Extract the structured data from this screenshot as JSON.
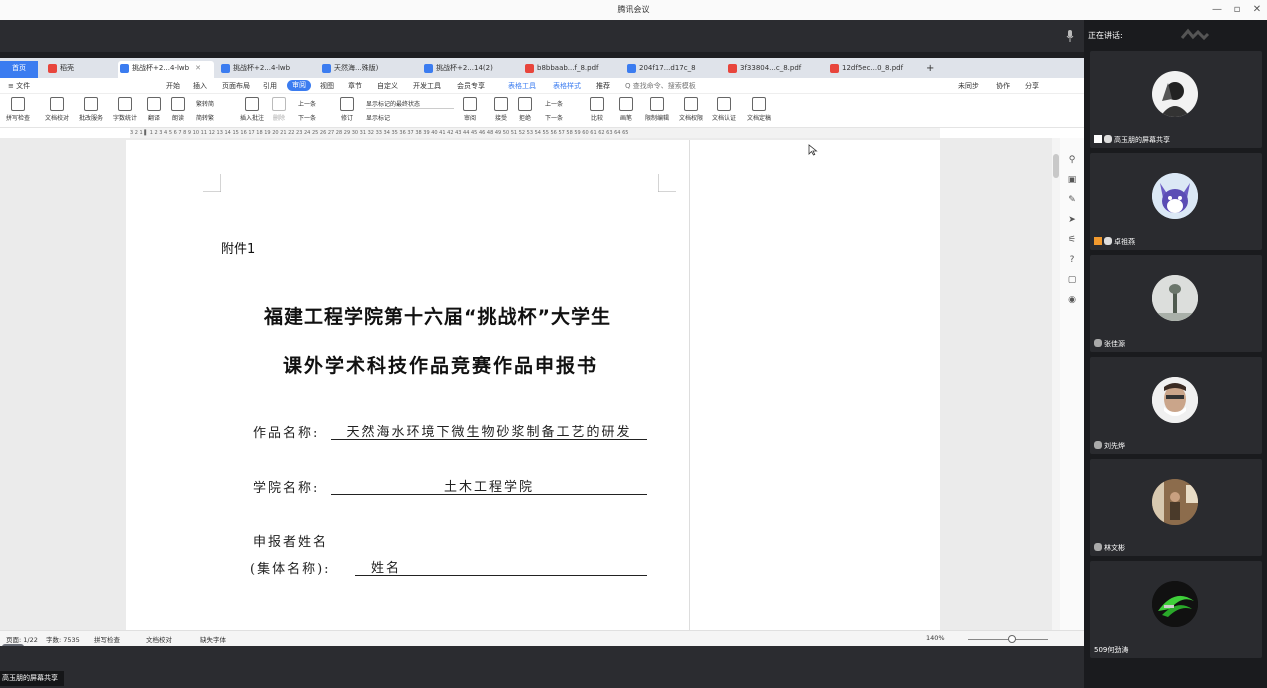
{
  "window": {
    "title": "腾讯会议",
    "controls": [
      "—",
      "▫",
      "✕"
    ]
  },
  "meeting": {
    "speaking_label": "正在讲话:",
    "share_label": "高玉朋的屏幕共享"
  },
  "participants": [
    {
      "name": "高玉朋的屏幕共享",
      "avatar": "man-dark-avatar"
    },
    {
      "name": "卓祖燕",
      "avatar": "cartoon-dog-avatar"
    },
    {
      "name": "张佳源",
      "avatar": "tree-fog-avatar"
    },
    {
      "name": "刘先烨",
      "avatar": "man-face-avatar"
    },
    {
      "name": "林文彬",
      "avatar": "person-room-avatar"
    },
    {
      "name": "509何劲涛",
      "avatar": "green-logo-avatar"
    }
  ],
  "wps": {
    "home_tab": "首页",
    "tabs": [
      {
        "label": "稻壳",
        "color": "#e8453c"
      },
      {
        "label": "挑战杯+2...4-lwb",
        "color": "#3b7cf0",
        "active": true
      },
      {
        "label": "挑战杯+2...4-lwb",
        "color": "#3b7cf0"
      },
      {
        "label": "天然海...殊版)",
        "color": "#3b7cf0"
      },
      {
        "label": "挑战杯+2...14(2)",
        "color": "#3b7cf0"
      },
      {
        "label": "b8bbaab...f_8.pdf",
        "color": "#e8453c"
      },
      {
        "label": "204f17...d17c_8",
        "color": "#3b7cf0"
      },
      {
        "label": "3f33804...c_8.pdf",
        "color": "#e8453c"
      },
      {
        "label": "12df5ec...0_8.pdf",
        "color": "#e8453c"
      }
    ],
    "menu": {
      "file": "≡ 文件",
      "items": [
        "开始",
        "插入",
        "页面布局",
        "引用",
        "审阅",
        "视图",
        "章节",
        "自定义",
        "开发工具",
        "会员专享"
      ],
      "active": "审阅",
      "table_tools": "表格工具",
      "table_style": "表格样式",
      "recommend": "推荐",
      "search": "Q 查找命令、搜索模板",
      "sync": "未同步",
      "collab": "协作",
      "share": "分享"
    },
    "toolbar": {
      "spell": "拼写检查",
      "proof": "文档校对",
      "batch": "批改服务",
      "wordcount": "字数统计",
      "translate": "翻译",
      "read": "朗读",
      "fan_jian": "繁转简",
      "jian_fan": "简转繁",
      "insert_comment": "插入批注",
      "delete": "删除",
      "prev_comment": "上一条",
      "next_comment": "下一条",
      "revise": "修订",
      "show_markup_select": "显示标记的最终状态",
      "show_markup": "显示标记",
      "review": "审阅",
      "accept": "接受",
      "reject": "拒绝",
      "prev": "上一条",
      "next": "下一条",
      "compare": "比较",
      "pen": "画笔",
      "restrict": "限制编辑",
      "permission": "文档权限",
      "certify": "文档认证",
      "finalize": "文档定稿"
    },
    "ruler_text": "3  2  1  ▌ 1  2  3  4  5  6  7  8  9  10  11  12  13  14  15  16  17  18  19  20  21  22  23  24  25  26  27  28  29  30  31  32  33  34  35  36  37  38  39  40  41  42  43  44  45  46  48  49  50  51  52  53  54  55  56  57  58  59  60  61  62  63  64  65",
    "document": {
      "attach": "附件1",
      "title1": "福建工程学院第十六届“挑战杯”大学生",
      "title2": "课外学术科技作品竞赛作品申报书",
      "work_label": "作品名称:",
      "work_value": "天然海水环境下微生物砂浆制备工艺的研发",
      "college_label": "学院名称:",
      "college_value": "土木工程学院",
      "applicant_label": "申报者姓名",
      "group_label": "(集体名称):",
      "group_value": "姓名"
    },
    "status": {
      "page": "页面: 1/22",
      "words": "字数: 7535",
      "spell": "拼写检查",
      "proof": "文档校对",
      "missing_font": "缺失字体",
      "zoom": "140%"
    }
  },
  "colors": {
    "accent": "#3b7cf0",
    "pdf_red": "#e8453c",
    "meeting_bg": "#2b2c30"
  }
}
